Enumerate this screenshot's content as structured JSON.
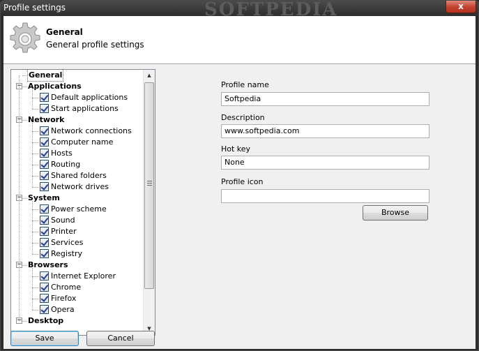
{
  "window": {
    "title": "Profile settings",
    "watermark": "SOFTPEDIA",
    "close_label": "x"
  },
  "header": {
    "title": "General",
    "subtitle": "General profile settings",
    "icon": "gear-icon"
  },
  "tree": {
    "root": "General",
    "groups": [
      {
        "label": "Applications",
        "items": [
          "Default applications",
          "Start applications"
        ]
      },
      {
        "label": "Network",
        "items": [
          "Network connections",
          "Computer name",
          "Hosts",
          "Routing",
          "Shared folders",
          "Network drives"
        ]
      },
      {
        "label": "System",
        "items": [
          "Power scheme",
          "Sound",
          "Printer",
          "Services",
          "Registry"
        ]
      },
      {
        "label": "Browsers",
        "items": [
          "Internet Explorer",
          "Chrome",
          "Firefox",
          "Opera"
        ]
      },
      {
        "label": "Desktop",
        "items": []
      }
    ],
    "all_checked": true
  },
  "form": {
    "profile_name": {
      "label": "Profile name",
      "value": "Softpedia"
    },
    "description": {
      "label": "Description",
      "value": "www.softpedia.com"
    },
    "hot_key": {
      "label": "Hot key",
      "value": "None"
    },
    "profile_icon": {
      "label": "Profile icon",
      "value": ""
    },
    "browse_label": "Browse"
  },
  "footer": {
    "save_label": "Save",
    "cancel_label": "Cancel"
  }
}
